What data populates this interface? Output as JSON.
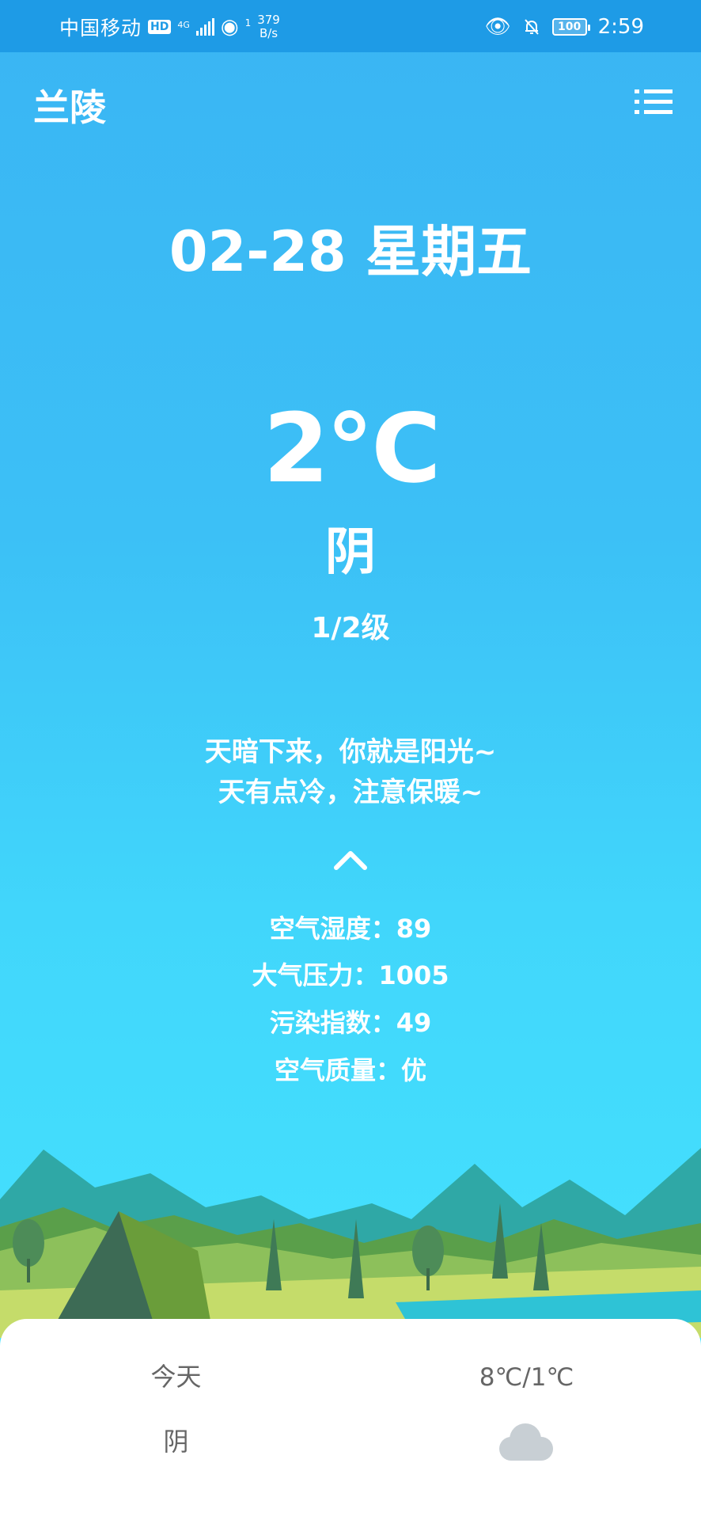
{
  "status_bar": {
    "carrier": "中国移动",
    "hd": "HD",
    "network": "4G",
    "wifi_badge": "1",
    "speed_value": "379",
    "speed_unit": "B/s",
    "battery": "100",
    "time": "2:59"
  },
  "header": {
    "city": "兰陵"
  },
  "weather": {
    "date": "02-28 星期五",
    "temperature": "2℃",
    "condition": "阴",
    "wind_level": "1/2级",
    "tip_line1": "天暗下来，你就是阳光~",
    "tip_line2": "天有点冷，注意保暖~",
    "details": {
      "humidity": "空气湿度：89",
      "pressure": "大气压力：1005",
      "pollution": "污染指数：49",
      "air_quality": "空气质量：优"
    }
  },
  "forecast": {
    "day_label": "今天",
    "day_condition": "阴",
    "temp_range": "8℃/1℃",
    "icon": "cloud-icon"
  },
  "colors": {
    "status_bar": "#1e9be6",
    "sky_top": "#3ab5f3",
    "sky_bottom": "#46e6ff",
    "card_text": "#666666"
  }
}
